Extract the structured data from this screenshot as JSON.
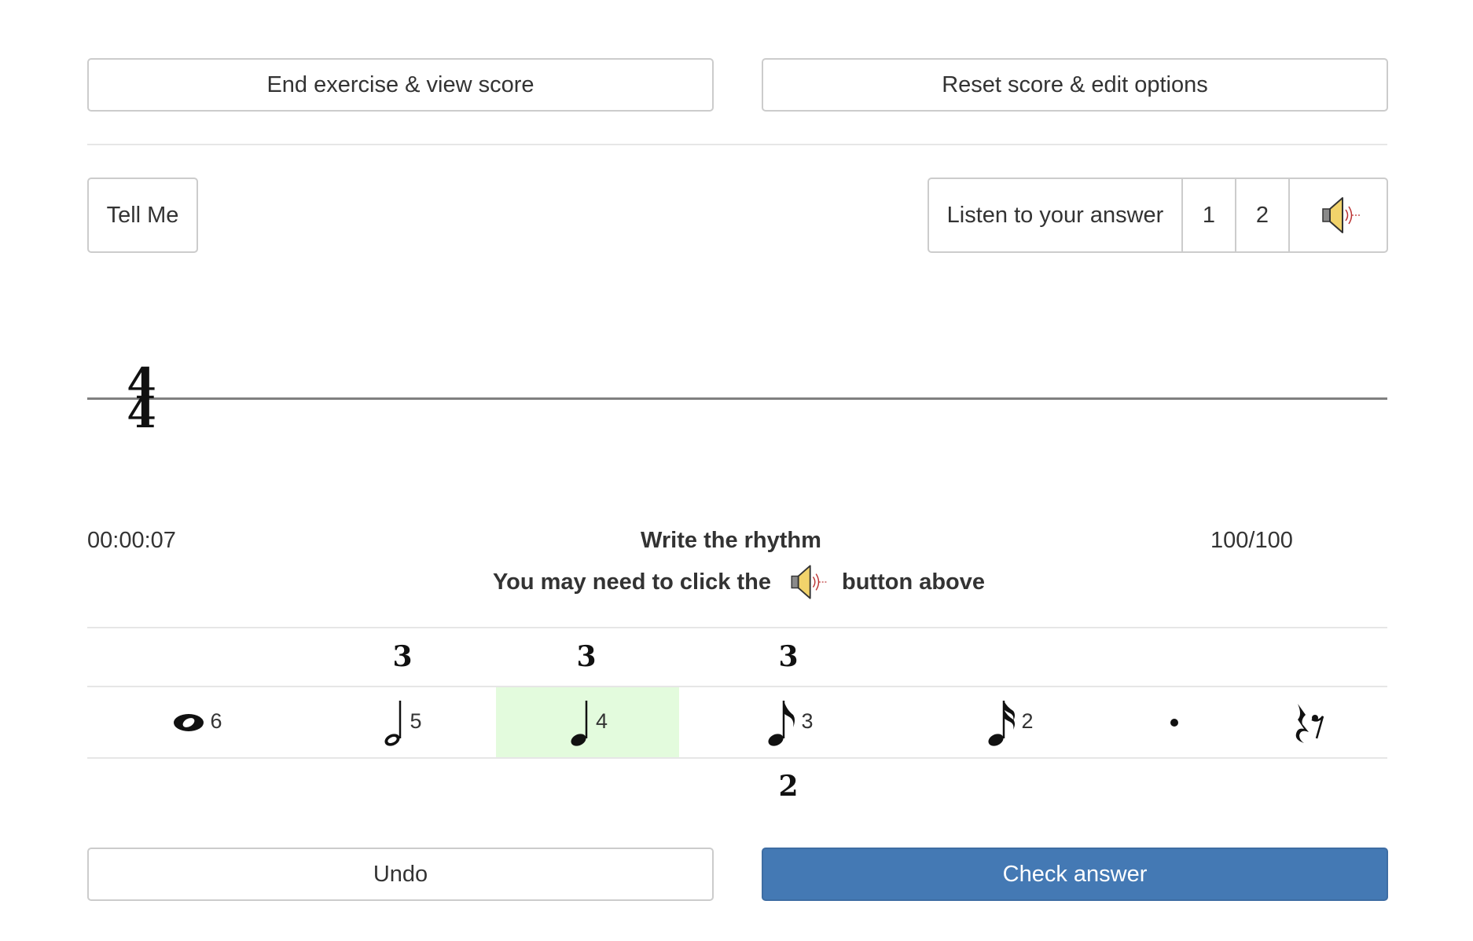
{
  "top_buttons": {
    "end_exercise": "End exercise & view score",
    "reset_score": "Reset score & edit options"
  },
  "controls": {
    "tell_me": "Tell Me",
    "listen_answer": "Listen to your answer",
    "play_1": "1",
    "play_2": "2",
    "play_icon": "speaker-icon"
  },
  "staff": {
    "time_signature_top": "4",
    "time_signature_bottom": "4"
  },
  "status": {
    "timer": "00:00:07",
    "title": "Write the rhythm",
    "score": "100/100",
    "hint_before": "You may need to click the",
    "hint_after": "button above"
  },
  "tuplets": {
    "triplet_1": "3",
    "triplet_2": "3",
    "triplet_3": "3",
    "duplet": "2"
  },
  "palette": [
    {
      "name": "whole-note",
      "glyph": "𝅝",
      "key": "6",
      "selected": false
    },
    {
      "name": "half-note",
      "glyph": "𝅗𝅥",
      "key": "5",
      "selected": false
    },
    {
      "name": "quarter-note",
      "glyph": "♩",
      "key": "4",
      "selected": true
    },
    {
      "name": "eighth-note",
      "glyph": "♪",
      "key": "3",
      "selected": false
    },
    {
      "name": "sixteenth-note",
      "glyph": "𝅘𝅥𝅯",
      "key": "2",
      "selected": false
    },
    {
      "name": "dot",
      "glyph": "•",
      "key": "",
      "selected": false
    },
    {
      "name": "rest",
      "glyph": "𝄽",
      "key": "",
      "selected": false
    }
  ],
  "bottom_buttons": {
    "undo": "Undo",
    "check_answer": "Check answer"
  },
  "colors": {
    "primary": "#4479b4",
    "selected_cell": "#e3fbdd",
    "border": "#cccccc"
  }
}
